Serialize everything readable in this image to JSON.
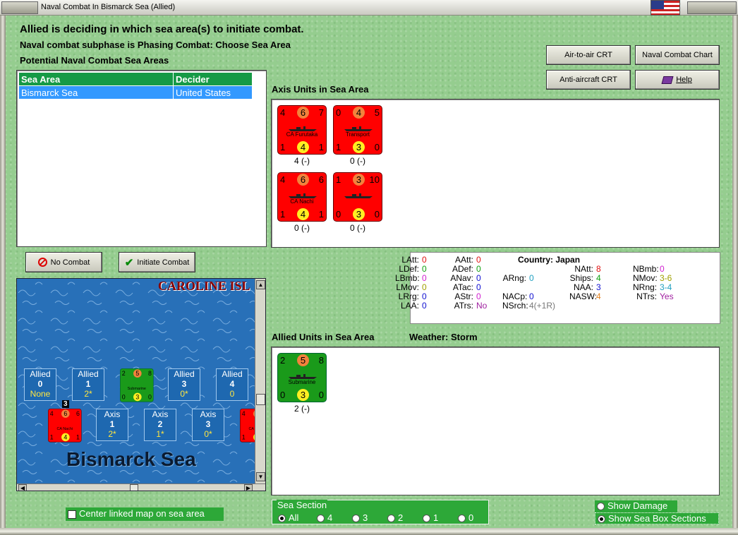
{
  "window": {
    "title": "Naval Combat In Bismarck Sea (Allied)"
  },
  "header": {
    "line1": "Allied is deciding in which sea area(s) to initiate combat.",
    "line2": "Naval combat subphase is Phasing Combat: Choose Sea Area",
    "line3": "Potential Naval Combat Sea Areas"
  },
  "buttons": {
    "air_to_air": "Air-to-air CRT",
    "naval_chart": "Naval Combat Chart",
    "anti_aircraft": "Anti-aircraft CRT",
    "help": "Help",
    "no_combat": "No Combat",
    "initiate_combat": "Initiate Combat"
  },
  "sea_table": {
    "headers": [
      "Sea Area",
      "Decider"
    ],
    "rows": [
      [
        "Bismarck Sea",
        "United States"
      ]
    ]
  },
  "axis_panel": {
    "title": "Axis Units in Sea Area",
    "units": [
      {
        "tl": "4",
        "tc": "6",
        "tr": "7",
        "bl": "1",
        "bc": "4",
        "br": "1",
        "name": "CA Furutaka",
        "caption": "4 (-)"
      },
      {
        "tl": "0",
        "tc": "4",
        "tr": "5",
        "bl": "1",
        "bc": "3",
        "br": "0",
        "name": "Transport",
        "caption": "0 (-)"
      },
      {
        "tl": "4",
        "tc": "6",
        "tr": "6",
        "bl": "1",
        "bc": "4",
        "br": "1",
        "name": "CA Nachi",
        "caption": "0 (-)"
      },
      {
        "tl": "1",
        "tc": "3",
        "tr": "10",
        "bl": "0",
        "bc": "3",
        "br": "0",
        "name": "",
        "caption": "0 (-)"
      }
    ]
  },
  "stats": {
    "country_label": "Country:",
    "country": "Japan",
    "items": [
      {
        "k": "LAtt:",
        "v": "0",
        "c": "#e01010"
      },
      {
        "k": "LDef:",
        "v": "0",
        "c": "#10a010"
      },
      {
        "k": "LBmb:",
        "v": "0",
        "c": "#d020d0"
      },
      {
        "k": "LMov:",
        "v": "0",
        "c": "#a0a000"
      },
      {
        "k": "LRrg:",
        "v": "0",
        "c": "#1010d0"
      },
      {
        "k": "LAA:",
        "v": "0",
        "c": "#1010d0"
      },
      {
        "k": "AAtt:",
        "v": "0",
        "c": "#e01010"
      },
      {
        "k": "ADef:",
        "v": "0",
        "c": "#10a010"
      },
      {
        "k": "ANav:",
        "v": "0",
        "c": "#1010d0"
      },
      {
        "k": "ATac:",
        "v": "0",
        "c": "#1010d0"
      },
      {
        "k": "AStr:",
        "v": "0",
        "c": "#d020d0"
      },
      {
        "k": "ATrs:",
        "v": "No",
        "c": "#a020a0"
      },
      {
        "k": "ARng:",
        "v": "0",
        "c": "#20a0c0"
      },
      {
        "k": "NACp:",
        "v": "0",
        "c": "#1010d0"
      },
      {
        "k": "NSrch:",
        "v": "4(+1R)",
        "c": "#777777"
      },
      {
        "k": "NAtt:",
        "v": "8",
        "c": "#e01010"
      },
      {
        "k": "Ships:",
        "v": "4",
        "c": "#10a010"
      },
      {
        "k": "NAA:",
        "v": "3",
        "c": "#1010d0"
      },
      {
        "k": "NASW:",
        "v": "4",
        "c": "#e08020"
      },
      {
        "k": "NBmb:",
        "v": "0",
        "c": "#d020d0"
      },
      {
        "k": "NMov:",
        "v": "3-6",
        "c": "#a0a000"
      },
      {
        "k": "NRng:",
        "v": "3-4",
        "c": "#20a0c0"
      },
      {
        "k": "NTrs:",
        "v": "Yes",
        "c": "#a020a0"
      }
    ]
  },
  "allied_panel": {
    "title": "Allied Units in Sea Area",
    "weather_label": "Weather:",
    "weather": "Storm",
    "units": [
      {
        "tl": "2",
        "tc": "5",
        "tr": "8",
        "bl": "0",
        "bc": "3",
        "br": "0",
        "name": "Submarine",
        "caption": "2 (-)"
      }
    ]
  },
  "map": {
    "label": "CAROLINE ISL",
    "sea_name": "Bismarck Sea",
    "allied_boxes": [
      {
        "side": "Allied",
        "num": "0",
        "val": "None"
      },
      {
        "side": "Allied",
        "num": "1",
        "val": "2*"
      },
      {
        "side": "Allied",
        "num": "3",
        "val": "0*"
      },
      {
        "side": "Allied",
        "num": "4",
        "val": "0"
      }
    ],
    "axis_boxes": [
      {
        "side": "Axis",
        "num": "1",
        "val": "2*"
      },
      {
        "side": "Axis",
        "num": "2",
        "val": "1*"
      },
      {
        "side": "Axis",
        "num": "3",
        "val": "0*"
      }
    ],
    "sub_counter": {
      "tl": "2",
      "tc": "5",
      "tr": "8",
      "bl": "0",
      "bc": "3",
      "br": "0",
      "name": "Submarine"
    },
    "jp_counter": {
      "tl": "4",
      "tc": "6",
      "tr": "6",
      "bl": "1",
      "bc": "4",
      "br": "1",
      "name": "CA Nachi",
      "stack": "3"
    }
  },
  "center_map": "Center linked map on sea area",
  "sea_section": {
    "label": "Sea Section",
    "options": [
      "All",
      "4",
      "3",
      "2",
      "1",
      "0"
    ],
    "selected": "All"
  },
  "display": {
    "damage": "Show Damage",
    "sections": "Show Sea Box Sections",
    "selected": "Show Sea Box Sections"
  }
}
